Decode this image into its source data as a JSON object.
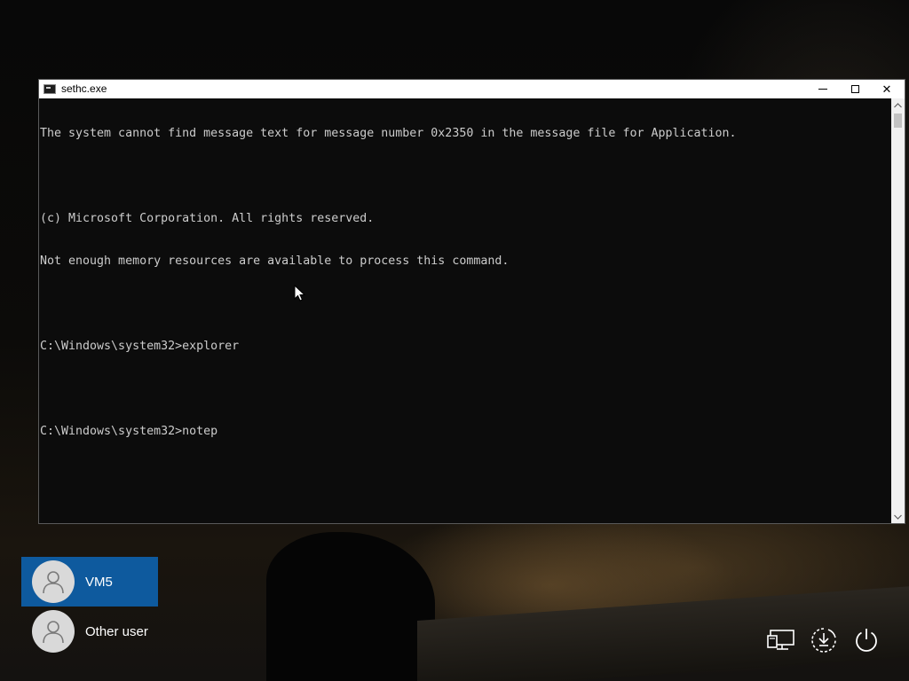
{
  "window": {
    "title": "sethc.exe",
    "icon": "console-icon",
    "controls": {
      "minimize": "minimize-icon",
      "maximize": "maximize-icon",
      "close": "close-icon",
      "close_glyph": "✕"
    }
  },
  "console": {
    "lines": [
      "The system cannot find message text for message number 0x2350 in the message file for Application.",
      "",
      "(c) Microsoft Corporation. All rights reserved.",
      "Not enough memory resources are available to process this command.",
      "",
      "C:\\Windows\\system32>explorer",
      "",
      "C:\\Windows\\system32>notep"
    ],
    "text_color": "#cccccc",
    "background": "#0c0c0c"
  },
  "users": [
    {
      "name": "VM5",
      "selected": true
    },
    {
      "name": "Other user",
      "selected": false
    }
  ],
  "system_icons": {
    "network": "network-icon",
    "ease_of_access": "ease-of-access-icon",
    "power": "power-icon"
  },
  "colors": {
    "selected_user_tile": "#0e5a9e",
    "avatar_bg": "#d9d9d9"
  }
}
